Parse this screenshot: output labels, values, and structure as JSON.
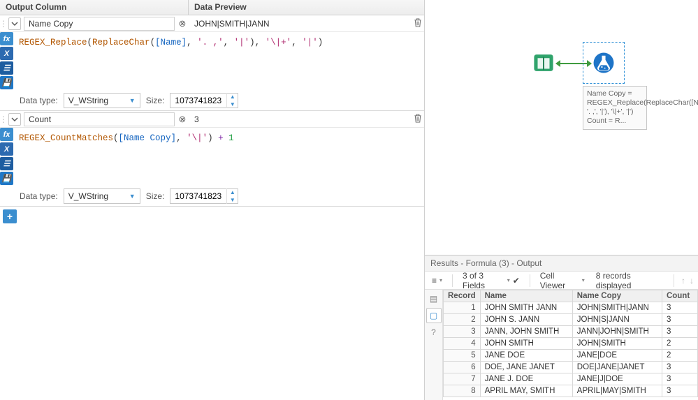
{
  "headers": {
    "output": "Output Column",
    "preview": "Data Preview"
  },
  "expr1": {
    "column": "Name Copy",
    "preview": "JOHN|SMITH|JANN",
    "code_html": "<span class='fn'>REGEX_Replace</span>(<span class='fn'>ReplaceChar</span>(<span class='fld'>[Name]</span>, <span class='str'>'. ,'</span>, <span class='str'>'|'</span>), <span class='str'>'\\|+'</span>, <span class='str'>'|'</span>)",
    "datatype_label": "Data type:",
    "datatype": "V_WString",
    "size_label": "Size:",
    "size": "1073741823"
  },
  "expr2": {
    "column": "Count",
    "preview": "3",
    "code_html": "<span class='fn'>REGEX_CountMatches</span>(<span class='fld'>[Name Copy]</span>, <span class='str'>'\\|'</span>) <span class='op'>+</span> <span class='num'>1</span>",
    "datatype_label": "Data type:",
    "datatype": "V_WString",
    "size_label": "Size:",
    "size": "1073741823"
  },
  "annotation": "Name Copy = REGEX_Replace(ReplaceChar([Name], '. ,', '|'), '\\|+', '|')\nCount = R...",
  "results": {
    "title": "Results - Formula (3) - Output",
    "fields": "3 of 3 Fields",
    "cellviewer": "Cell Viewer",
    "records": "8 records displayed",
    "columns": [
      "Record",
      "Name",
      "Name Copy",
      "Count"
    ],
    "rows": [
      [
        "1",
        "JOHN SMITH JANN",
        "JOHN|SMITH|JANN",
        "3"
      ],
      [
        "2",
        "JOHN S. JANN",
        "JOHN|S|JANN",
        "3"
      ],
      [
        "3",
        "JANN, JOHN SMITH",
        "JANN|JOHN|SMITH",
        "3"
      ],
      [
        "4",
        "JOHN SMITH",
        "JOHN|SMITH",
        "2"
      ],
      [
        "5",
        "JANE DOE",
        "JANE|DOE",
        "2"
      ],
      [
        "6",
        "DOE, JANE JANET",
        "DOE|JANE|JANET",
        "3"
      ],
      [
        "7",
        "JANE J. DOE",
        "JANE|J|DOE",
        "3"
      ],
      [
        "8",
        "APRIL MAY, SMITH",
        "APRIL|MAY|SMITH",
        "3"
      ]
    ]
  }
}
